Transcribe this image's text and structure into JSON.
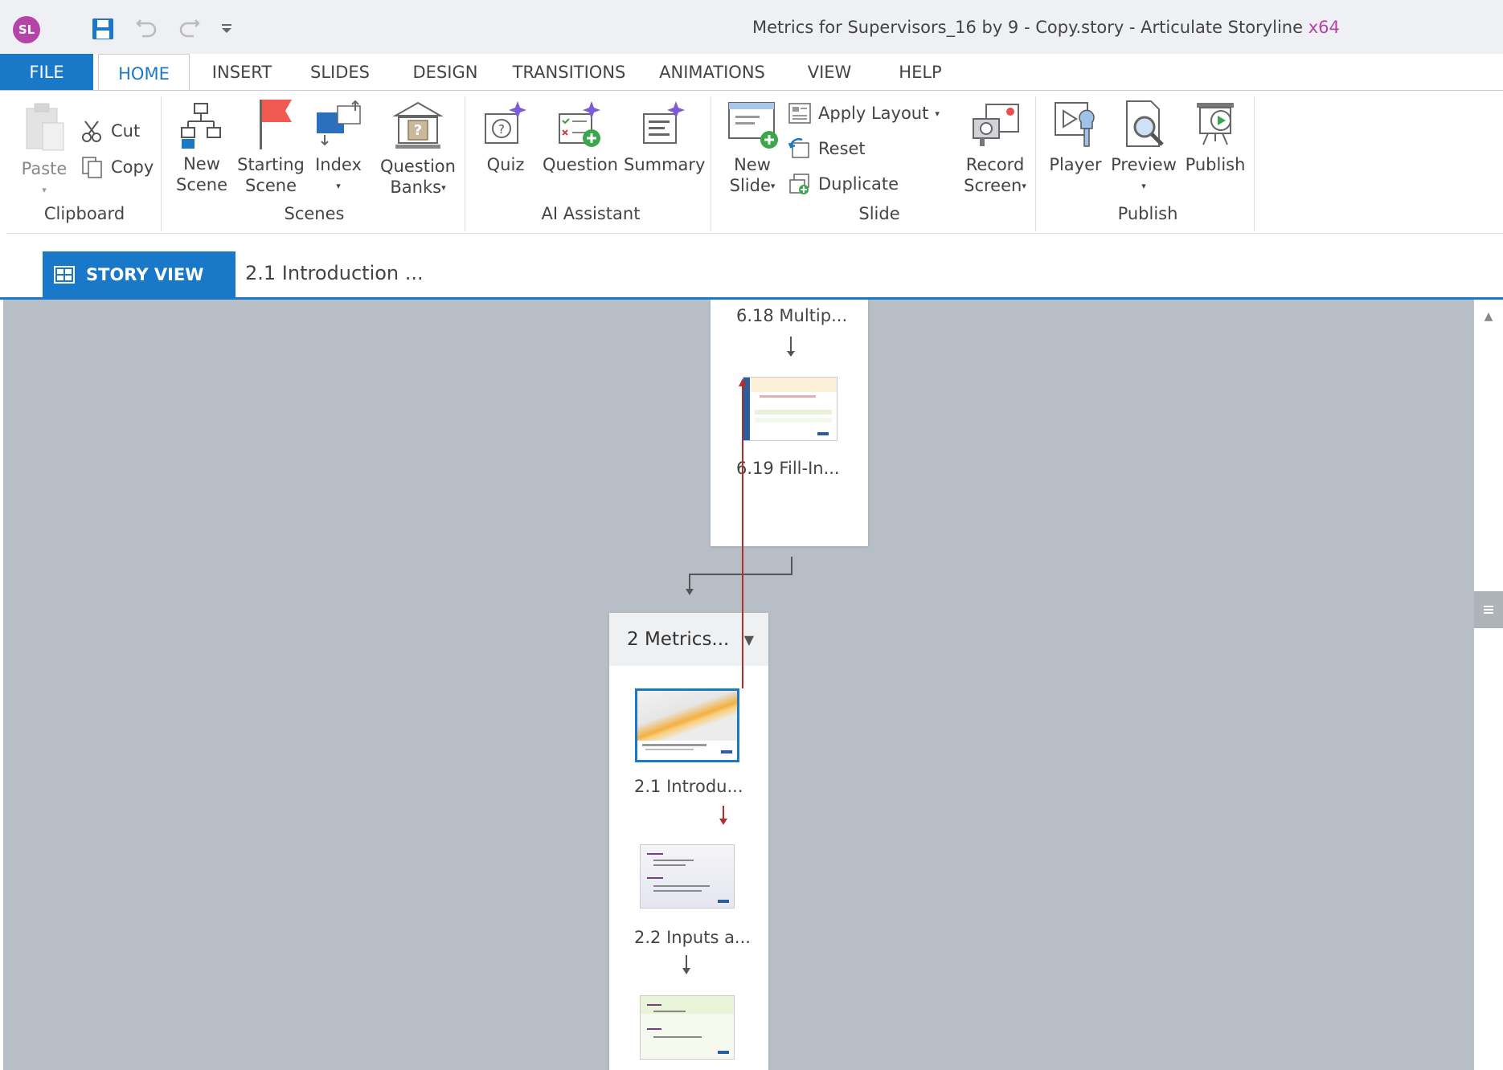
{
  "window": {
    "title": "Metrics for Supervisors_16 by 9 - Copy.story -  Articulate Storyline",
    "arch": "x64",
    "logo_text": "SL"
  },
  "quick_access": {
    "icons": [
      "save-icon",
      "undo-icon",
      "redo-icon",
      "customize-icon"
    ]
  },
  "ribbon_tabs": [
    "FILE",
    "HOME",
    "INSERT",
    "SLIDES",
    "DESIGN",
    "TRANSITIONS",
    "ANIMATIONS",
    "VIEW",
    "HELP"
  ],
  "active_tab": "HOME",
  "clipboard": {
    "paste": "Paste",
    "cut": "Cut",
    "copy": "Copy",
    "group": "Clipboard"
  },
  "scenes_group": {
    "new_scene_1": "New",
    "new_scene_2": "Scene",
    "starting_1": "Starting",
    "starting_2": "Scene",
    "index": "Index",
    "group": "Scenes"
  },
  "question_banks": {
    "line1": "Question",
    "line2": "Banks"
  },
  "ai_group": {
    "quiz": "Quiz",
    "question": "Question",
    "summary": "Summary",
    "group": "AI Assistant"
  },
  "slide_group": {
    "new_1": "New",
    "new_2": "Slide",
    "apply_layout": "Apply Layout",
    "reset": "Reset",
    "duplicate": "Duplicate",
    "group": "Slide"
  },
  "record": {
    "line1": "Record",
    "line2": "Screen"
  },
  "publish_group": {
    "player": "Player",
    "preview": "Preview",
    "publish": "Publish",
    "group": "Publish"
  },
  "view_bar": {
    "story_view": "STORY VIEW",
    "slide_tab": "2.1 Introduction ..."
  },
  "story": {
    "upper_scene": {
      "slide_a": "6.18 Multip...",
      "slide_b": "6.19 Fill-In..."
    },
    "lower_scene": {
      "title": "2  Metrics...",
      "slides": [
        "2.1 Introdu...",
        "2.2 Inputs a..."
      ]
    }
  },
  "colors": {
    "accent": "#1a78c8",
    "brand": "#b543a8",
    "canvas": "#b8bec6",
    "trigger_line": "#b03030"
  }
}
